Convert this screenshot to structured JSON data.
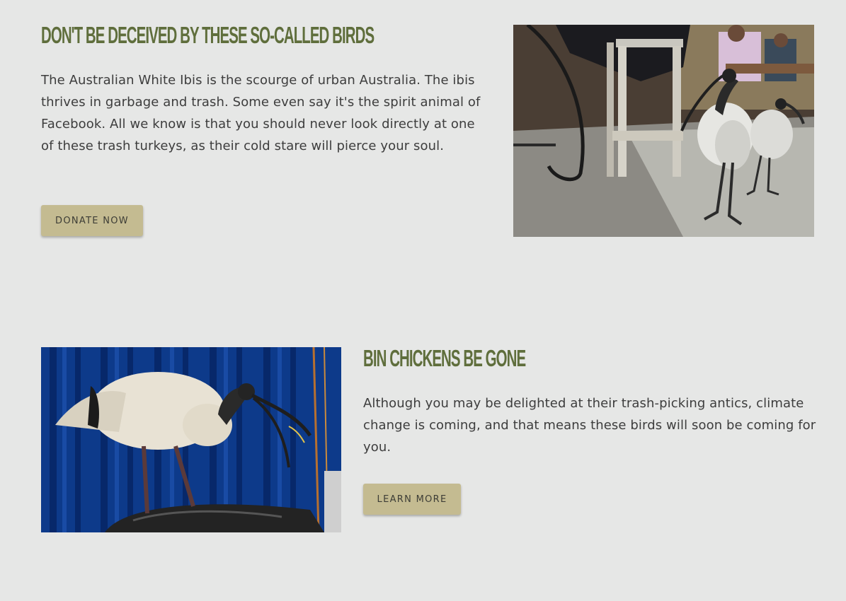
{
  "section1": {
    "heading": "Don't be deceived by these so-called birds",
    "body": "The Australian White Ibis is the scourge of urban Australia. The ibis thrives in garbage and trash. Some even say it's the spirit animal of Facebook. All we know is that you should never look directly at one of these trash turkeys, as their cold stare will pierce your soul.",
    "button_label": "DONATE NOW",
    "image": "photo of ibises walking under cafe tables and stools"
  },
  "section2": {
    "heading": "Bin chickens be gone",
    "body": "Although you may be delighted at their trash-picking antics, climate change is coming, and that means these birds will soon be coming for you.",
    "button_label": "LEARN MORE",
    "image": "photo of an ibis standing on a garbage bag in front of a blue curtain"
  },
  "colors": {
    "background": "#e6e7e6",
    "heading": "#5f6e3c",
    "button": "#c4bb91",
    "text": "#3d3d3d"
  }
}
